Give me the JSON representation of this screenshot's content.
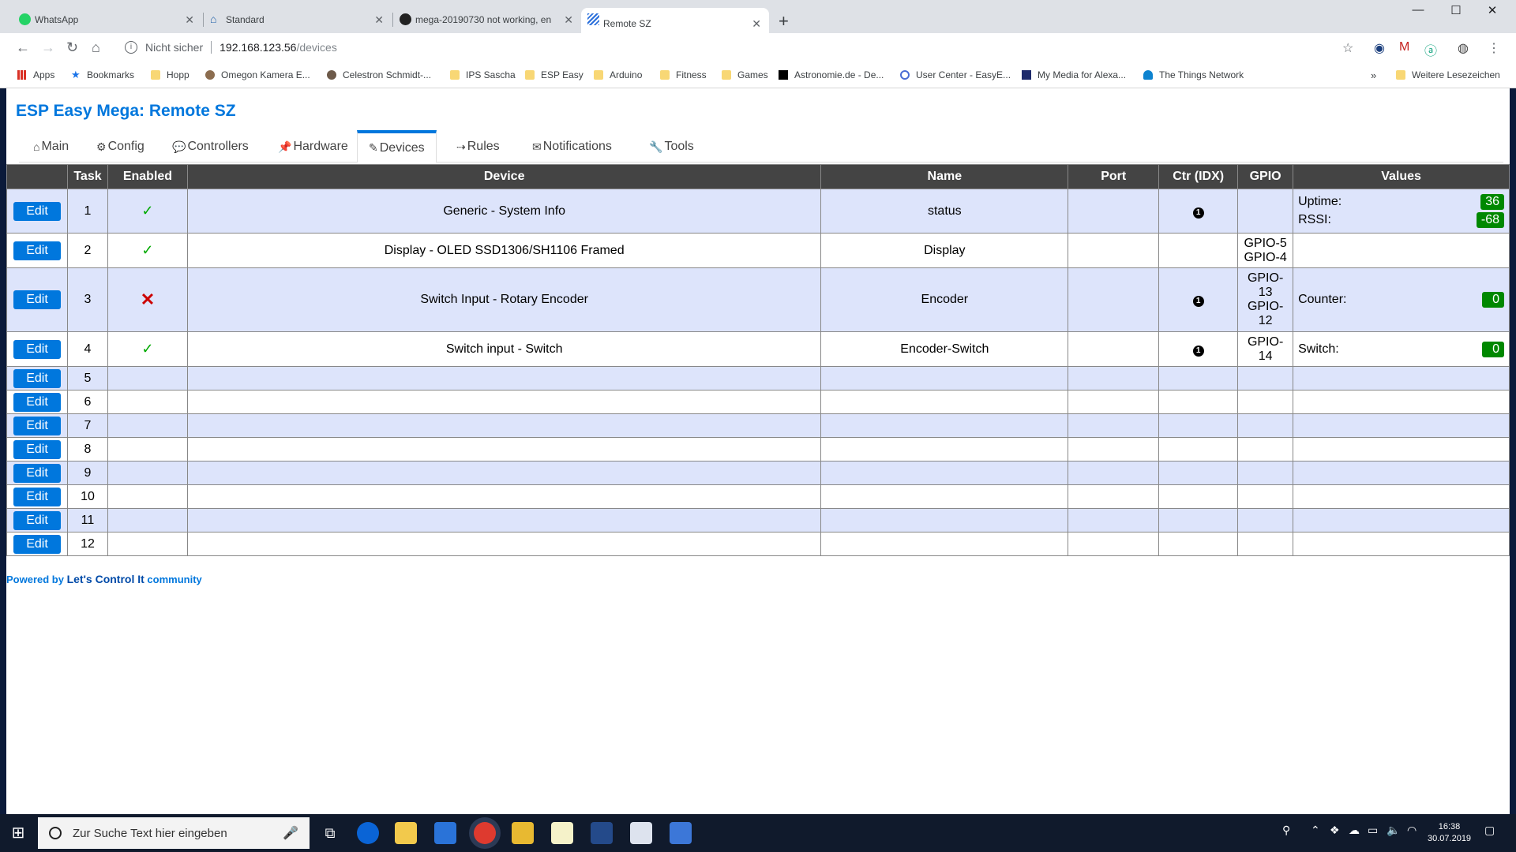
{
  "browser": {
    "tabs": [
      {
        "title": "WhatsApp",
        "favicon_color": "#25d366"
      },
      {
        "title": "Standard",
        "favicon_color": "#1f5fa8"
      },
      {
        "title": "mega-20190730 not working, en",
        "favicon_color": "#222222"
      },
      {
        "title": "Remote SZ",
        "favicon_color": "#2a6fdb"
      }
    ],
    "address": {
      "security": "Nicht sicher",
      "host": "192.168.123.56",
      "path": "/devices"
    },
    "bookmarks": [
      "Apps",
      "Bookmarks",
      "Hopp",
      "Omegon Kamera E...",
      "Celestron Schmidt-...",
      "IPS Sascha",
      "ESP Easy",
      "Arduino",
      "Fitness",
      "Games",
      "Astronomie.de - De...",
      "User Center - EasyE...",
      "My Media for Alexa...",
      "The Things Network",
      "Weitere Lesezeichen"
    ]
  },
  "page": {
    "title": "ESP Easy Mega: Remote SZ",
    "menu": [
      {
        "icon": "⌂",
        "label": "Main"
      },
      {
        "icon": "⚙",
        "label": "Config"
      },
      {
        "icon": "💬",
        "label": "Controllers"
      },
      {
        "icon": "📌",
        "label": "Hardware"
      },
      {
        "icon": "✎",
        "label": "Devices"
      },
      {
        "icon": "⇢",
        "label": "Rules"
      },
      {
        "icon": "✉",
        "label": "Notifications"
      },
      {
        "icon": "🔧",
        "label": "Tools"
      }
    ],
    "table": {
      "headers": [
        "",
        "Task",
        "Enabled",
        "Device",
        "Name",
        "Port",
        "Ctr (IDX)",
        "GPIO",
        "Values"
      ],
      "edit_label": "Edit",
      "ctr_marker": "1"
    },
    "footer": {
      "prefix": "Powered by ",
      "brand": "Let's Control It",
      "suffix": " community"
    }
  },
  "taskbar": {
    "search_placeholder": "Zur Suche Text hier eingeben",
    "time": "16:38",
    "date": "30.07.2019"
  }
}
